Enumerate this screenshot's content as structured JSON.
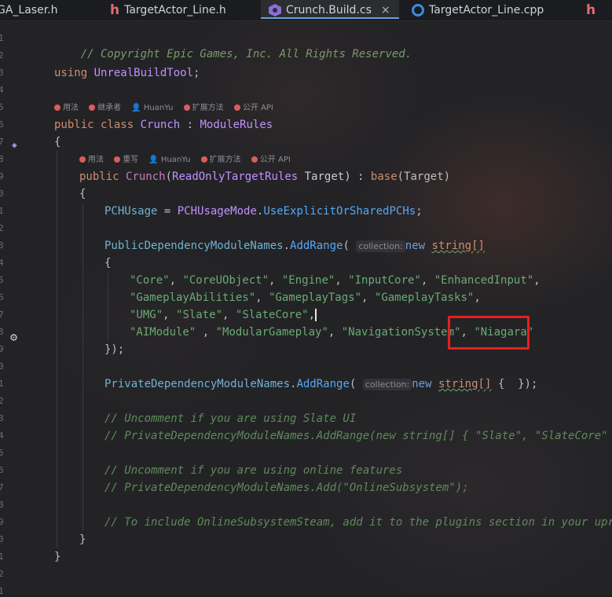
{
  "tabs": [
    {
      "label": "GA_Laser.h",
      "icon": "header-file-icon"
    },
    {
      "label": "TargetActor_Line.h",
      "icon": "header-file-icon"
    },
    {
      "label": "Crunch.Build.cs",
      "icon": "csharp-file-icon",
      "active": true
    },
    {
      "label": "TargetActor_Line.cpp",
      "icon": "cpp-file-icon"
    },
    {
      "label": "h",
      "icon": "header-file-icon"
    }
  ],
  "close_glyph": "×",
  "gutter": {
    "line_numbers": [
      "1",
      "2",
      "3",
      "4",
      "5",
      "6",
      "7",
      "8",
      "9",
      "0",
      "1",
      "2",
      "3",
      "4",
      "5",
      "6",
      "7",
      "8",
      "9",
      "0",
      "1",
      "2",
      "3",
      "4",
      "5",
      "6",
      "7",
      "8",
      "9",
      "0",
      "1",
      "2"
    ],
    "tail_digit": "1"
  },
  "hints": {
    "class_hint": {
      "usages": "用法",
      "inheritors": "继承者",
      "author": "HuanYu",
      "extension": "扩展方法",
      "public_api": "公开 API"
    },
    "ctor_hint": {
      "usages": "用法",
      "overrides": "重写",
      "author": "HuanYu",
      "extension": "扩展方法",
      "public_api": "公开 API"
    }
  },
  "code": {
    "copyright": "// Copyright Epic Games, Inc. All Rights Reserved.",
    "using_kw": "using",
    "using_ns": "UnrealBuildTool",
    "semi": ";",
    "public_kw": "public",
    "class_kw": "class",
    "class_name": "Crunch",
    "colon": " : ",
    "base_class": "ModuleRules",
    "open_brace": "{",
    "close_brace": "}",
    "ctor_name": "Crunch",
    "ctor_param_type": "ReadOnlyTargetRules",
    "ctor_param_name": " Target) : ",
    "base_kw": "base",
    "base_arg": "(Target)",
    "pch_prop": "PCHUsage",
    "eq": " = ",
    "pch_enum": "PCHUsageMode",
    "pch_value": "UseExplicitOrSharedPCHs",
    "public_deps": "PublicDependencyModuleNames",
    "private_deps": "PrivateDependencyModuleNames",
    "add_range": "AddRange",
    "inlay_collection": "collection:",
    "new_kw": "new",
    "string_arr": "string[]",
    "row1": [
      "\"Core\"",
      "\"CoreUObject\"",
      "\"Engine\"",
      "\"InputCore\"",
      "\"EnhancedInput\""
    ],
    "row2": [
      "\"GameplayAbilities\"",
      "\"GameplayTags\"",
      "\"GameplayTasks\""
    ],
    "row3": [
      "\"UMG\"",
      "\"Slate\"",
      "\"SlateCore\""
    ],
    "row4": [
      "\"AIModule\"",
      "\"ModularGameplay\"",
      "\"NavigationSystem\"",
      "\"Niagara\""
    ],
    "close_call": "});",
    "private_tail": " {  });",
    "comment1": "// Uncomment if you are using Slate UI",
    "comment2": "// PrivateDependencyModuleNames.AddRange(new string[] { \"Slate\", \"SlateCore\" });",
    "comment3": "// Uncomment if you are using online features",
    "comment4": "// PrivateDependencyModuleNames.Add(\"OnlineSubsystem\");",
    "comment5": "// To include OnlineSubsystemSteam, add it to the plugins section in your uprojec"
  },
  "colors": {
    "background": "#232326",
    "keyword": "#cf8e6d",
    "string": "#6aab73",
    "comment": "#7a9a6a",
    "highlight_box": "#e81f1f"
  }
}
